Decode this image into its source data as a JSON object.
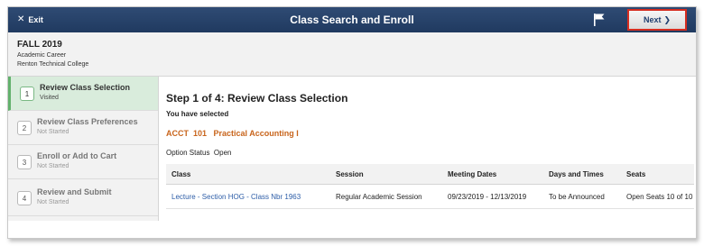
{
  "header": {
    "exit_label": "Exit",
    "title": "Class Search and Enroll",
    "next_label": "Next",
    "next_icon": "chevron-right-icon",
    "flag_icon": "flag-icon"
  },
  "info": {
    "term": "FALL 2019",
    "career": "Academic Career",
    "institution": "Renton Technical College"
  },
  "steps": [
    {
      "num": "1",
      "label": "Review Class Selection",
      "status": "Visited",
      "active": true
    },
    {
      "num": "2",
      "label": "Review Class Preferences",
      "status": "Not Started",
      "active": false
    },
    {
      "num": "3",
      "label": "Enroll or Add to Cart",
      "status": "Not Started",
      "active": false
    },
    {
      "num": "4",
      "label": "Review and Submit",
      "status": "Not Started",
      "active": false
    }
  ],
  "main": {
    "step_title": "Step 1 of 4: Review Class Selection",
    "selected_label": "You have selected",
    "course_title": "ACCT  101   Practical Accounting I",
    "option_status": "Option Status  Open"
  },
  "table": {
    "headers": [
      "Class",
      "Session",
      "Meeting Dates",
      "Days and Times",
      "Seats"
    ],
    "rows": [
      [
        "Lecture - Section HOG - Class Nbr 1963",
        "Regular Academic Session",
        "09/23/2019 - 12/13/2019",
        "To be Announced",
        "Open Seats 10 of 10"
      ]
    ]
  },
  "colors": {
    "header_bg": "#203a60",
    "active_step_bg": "#d9ecdc",
    "course_title": "#c8641b",
    "link": "#2e5ea8",
    "next_highlight": "#d62d20"
  }
}
